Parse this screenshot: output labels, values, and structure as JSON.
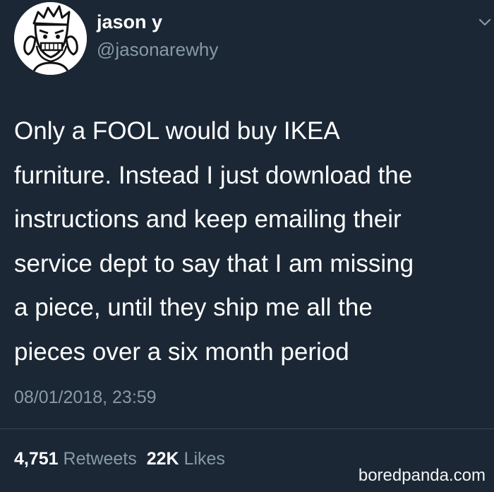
{
  "user": {
    "display_name": "jason y",
    "handle": "@jasonarewhy",
    "avatar_icon": "cartoon-face-avatar"
  },
  "tweet": {
    "lines": [
      "Only a FOOL would buy IKEA",
      "furniture. Instead I just download the",
      "instructions and keep emailing their",
      "service dept to say that I am missing",
      "a piece, until they ship me all the",
      "pieces over a six month period"
    ],
    "timestamp": "08/01/2018, 23:59"
  },
  "stats": {
    "retweets_count": "4,751",
    "retweets_label": "Retweets",
    "likes_count": "22K",
    "likes_label": "Likes"
  },
  "watermark": "boredpanda.com",
  "colors": {
    "background": "#1b2735",
    "text": "#ffffff",
    "muted": "#8899a6",
    "divider": "#38444d"
  }
}
